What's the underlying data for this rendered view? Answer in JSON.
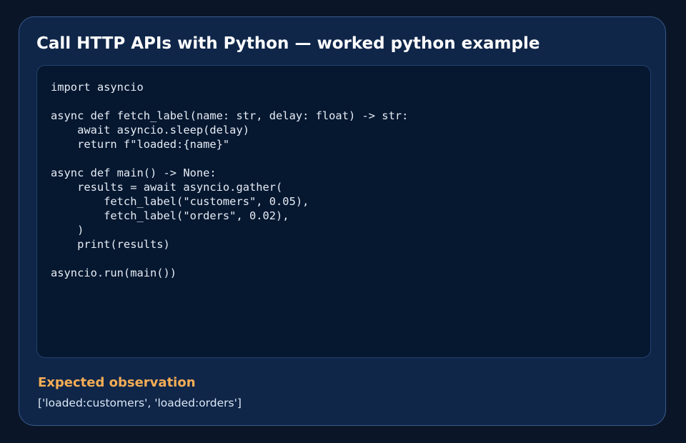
{
  "card": {
    "title": "Call HTTP APIs with Python — worked python example"
  },
  "code_block": {
    "language": "python",
    "code": "import asyncio\n\nasync def fetch_label(name: str, delay: float) -> str:\n    await asyncio.sleep(delay)\n    return f\"loaded:{name}\"\n\nasync def main() -> None:\n    results = await asyncio.gather(\n        fetch_label(\"customers\", 0.05),\n        fetch_label(\"orders\", 0.02),\n    )\n    print(results)\n\nasyncio.run(main())"
  },
  "observation": {
    "heading": "Expected observation",
    "value": "['loaded:customers', 'loaded:orders']"
  },
  "colors": {
    "page_background": "#0a1628",
    "card_background": "#0f2649",
    "card_border": "#3a5a8c",
    "code_background": "#061730",
    "title_text": "#ffffff",
    "code_text": "#e6edf5",
    "accent_heading": "#f6ad55",
    "observation_text": "#dbe7f5"
  }
}
